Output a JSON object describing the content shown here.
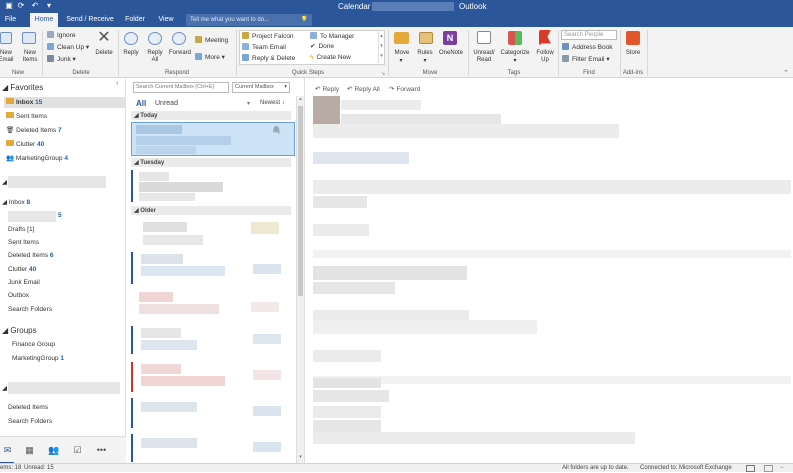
{
  "titlebar": {
    "title": "Calendar",
    "app": "Outlook"
  },
  "tabs": [
    {
      "label": "File"
    },
    {
      "label": "Home"
    },
    {
      "label": "Send / Receive"
    },
    {
      "label": "Folder"
    },
    {
      "label": "View"
    }
  ],
  "tellme": {
    "placeholder": "Tell me what you want to do..."
  },
  "ribbon": {
    "new_email": "New Email",
    "new_items": "New Items",
    "ignore": "Ignore",
    "clean_up": "Clean Up",
    "junk": "Junk",
    "delete": "Delete",
    "reply": "Reply",
    "reply_all": "Reply All",
    "forward": "Forward",
    "meeting": "Meeting",
    "more": "More",
    "qs_project_falcon": "Project Falcon",
    "qs_team_email": "Team Email",
    "qs_reply_delete": "Reply & Delete",
    "qs_to_manager": "To Manager",
    "qs_done": "Done",
    "qs_create_new": "Create New",
    "move": "Move",
    "rules": "Rules",
    "onenote": "OneNote",
    "unread_read": "Unread/ Read",
    "categorize": "Categorize",
    "follow_up": "Follow Up",
    "search_people": "Search People",
    "address_book": "Address Book",
    "filter_email": "Filter Email",
    "store": "Store",
    "groups": {
      "new": "New",
      "delete": "Delete",
      "respond": "Respond",
      "quick_steps": "Quick Steps",
      "move": "Move",
      "tags": "Tags",
      "find": "Find",
      "addins": "Add-ins"
    }
  },
  "nav": {
    "favorites": "Favorites",
    "fav_items": [
      {
        "label": "Inbox",
        "count": "15"
      },
      {
        "label": "Sent Items",
        "count": ""
      },
      {
        "label": "Deleted Items",
        "count": "7"
      },
      {
        "label": "Clutter",
        "count": "40"
      },
      {
        "label": "MarketingGroup",
        "count": "4"
      }
    ],
    "inbox": "Inbox",
    "inbox_count": "8",
    "sub_count": "5",
    "folders": [
      {
        "label": "Drafts [1]",
        "count": ""
      },
      {
        "label": "Sent Items",
        "count": ""
      },
      {
        "label": "Deleted Items",
        "count": "6"
      },
      {
        "label": "Clutter",
        "count": "40"
      },
      {
        "label": "Junk Email",
        "count": ""
      },
      {
        "label": "Outbox",
        "count": ""
      },
      {
        "label": "Search Folders",
        "count": ""
      }
    ],
    "groups": "Groups",
    "group_items": [
      {
        "label": "Finance Group",
        "count": ""
      },
      {
        "label": "MarketingGroup",
        "count": "1"
      }
    ],
    "second_folders": [
      {
        "label": "Deleted Items"
      },
      {
        "label": "Search Folders"
      }
    ]
  },
  "list": {
    "search_placeholder": "Search Current Mailbox (Ctrl+E)",
    "scope": "Current Mailbox",
    "filter_all": "All",
    "filter_unread": "Unread",
    "sort": "Newest",
    "headers": {
      "today": "Today",
      "tuesday": "Tuesday",
      "older": "Older"
    }
  },
  "reading": {
    "reply": "Reply",
    "reply_all": "Reply All",
    "forward": "Forward"
  },
  "status": {
    "items": "ems: 18",
    "unread": "Unread: 15",
    "sync": "All folders are up to date.",
    "connection": "Connected to: Microsoft Exchange"
  },
  "colors": {
    "accent": "#2b579a",
    "count": "#1f5fa8",
    "selected": "#cde3f7"
  }
}
